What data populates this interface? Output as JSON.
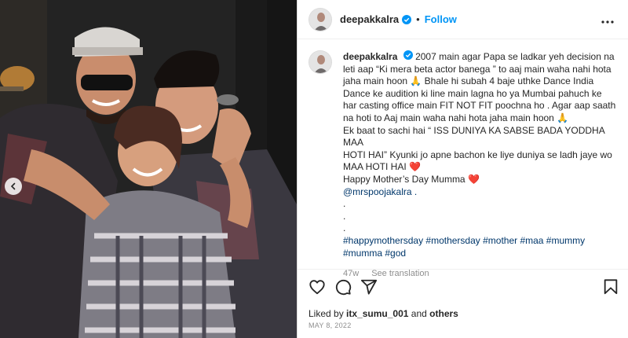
{
  "post": {
    "username": "deepakkalra",
    "follow_label": "Follow",
    "separator": "•",
    "caption_lines": [
      "2007 main agar Papa se ladkar yeh decision na",
      "leti aap “Ki mera beta actor banega ” to aaj main waha nahi hota",
      "jaha main hoon 🙏 Bhale hi subah 4 baje uthke Dance India",
      "Dance ke audition ki line main lagna ho ya Mumbai pahuch ke",
      "har casting office main FIT NOT FIT poochna ho . Agar aap saath",
      "na hoti to Aaj main waha nahi hota jaha main hoon 🙏",
      "Ek baat to sachi hai “ ISS DUNIYA KA SABSE BADA YODDHA MAA",
      "HOTI HAI” Kyunki jo apne bachon ke liye duniya se ladh jaye wo",
      "MAA HOTI HAI ❤️",
      "Happy Mother’s Day Mumma ❤️"
    ],
    "mention": "@mrspoojakalra .",
    "dots": [
      ".",
      ".",
      "."
    ],
    "hashtags_line1": "#happymothersday #mothersday #mother #maa #mummy",
    "hashtags_line2": "#mumma #god",
    "age": "47w",
    "see_translation": "See translation",
    "liked_by_prefix": "Liked by",
    "liked_by_user": "itx_sumu_001",
    "liked_by_and": "and",
    "liked_by_others": "others",
    "date": "MAY 8, 2022"
  },
  "icons": {
    "verified": "verified-badge-icon",
    "more": "more-options-icon",
    "like": "heart-icon",
    "comment": "comment-icon",
    "share": "share-icon",
    "save": "bookmark-icon",
    "carousel": "chevron-left-icon"
  },
  "colors": {
    "link": "#0095f6",
    "hashtag": "#00376b",
    "muted": "#8e8e8e",
    "text": "#262626"
  }
}
